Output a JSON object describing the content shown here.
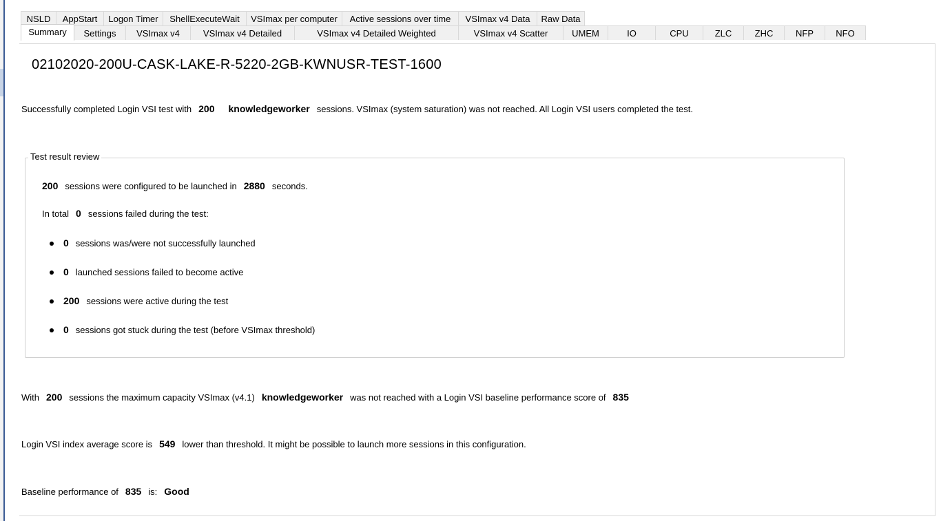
{
  "tabs": {
    "row_back": [
      "NSLD",
      "AppStart",
      "Logon Timer",
      "ShellExecuteWait",
      "VSImax per computer",
      "Active sessions over time",
      "VSImax v4 Data",
      "Raw Data"
    ],
    "row_front": [
      "Summary",
      "Settings",
      "VSImax v4",
      "VSImax v4 Detailed",
      "VSImax v4 Detailed Weighted",
      "VSImax v4 Scatter",
      "UMEM",
      "IO",
      "CPU",
      "ZLC",
      "ZHC",
      "NFP",
      "NFO"
    ],
    "selected": "Summary"
  },
  "summary": {
    "title": "02102020-200U-CASK-LAKE-R-5220-2GB-KWNUSR-TEST-1600",
    "intro": {
      "prefix": "Successfully completed Login VSI test with",
      "sessions": "200",
      "workload": "knowledgeworker",
      "suffix": "sessions. VSImax (system saturation) was not reached. All Login VSI users completed the test."
    },
    "review": {
      "legend": "Test result review",
      "configured": {
        "count": "200",
        "text1": "sessions were configured to be launched in",
        "seconds": "2880",
        "text2": "seconds."
      },
      "failed": {
        "prefix": "In total",
        "count": "0",
        "suffix": "sessions failed during the test:"
      },
      "bullets": [
        {
          "count": "0",
          "text": "sessions was/were not successfully launched"
        },
        {
          "count": "0",
          "text": "launched sessions failed to become active"
        },
        {
          "count": "200",
          "text": "sessions were active during the test"
        },
        {
          "count": "0",
          "text": "sessions got stuck during the test (before VSImax threshold)"
        }
      ]
    },
    "capacity": {
      "prefix": "With",
      "sessions": "200",
      "text1": "sessions the maximum capacity VSImax (v4.1)",
      "workload": "knowledgeworker",
      "text2": "was not reached with a Login VSI baseline performance score of",
      "score": "835"
    },
    "index": {
      "prefix": "Login VSI index average score is",
      "score": "549",
      "suffix": "lower than threshold. It might be possible to launch more sessions in this configuration."
    },
    "baseline": {
      "prefix": "Baseline performance of",
      "score": "835",
      "mid": "is:",
      "rating": "Good"
    }
  }
}
